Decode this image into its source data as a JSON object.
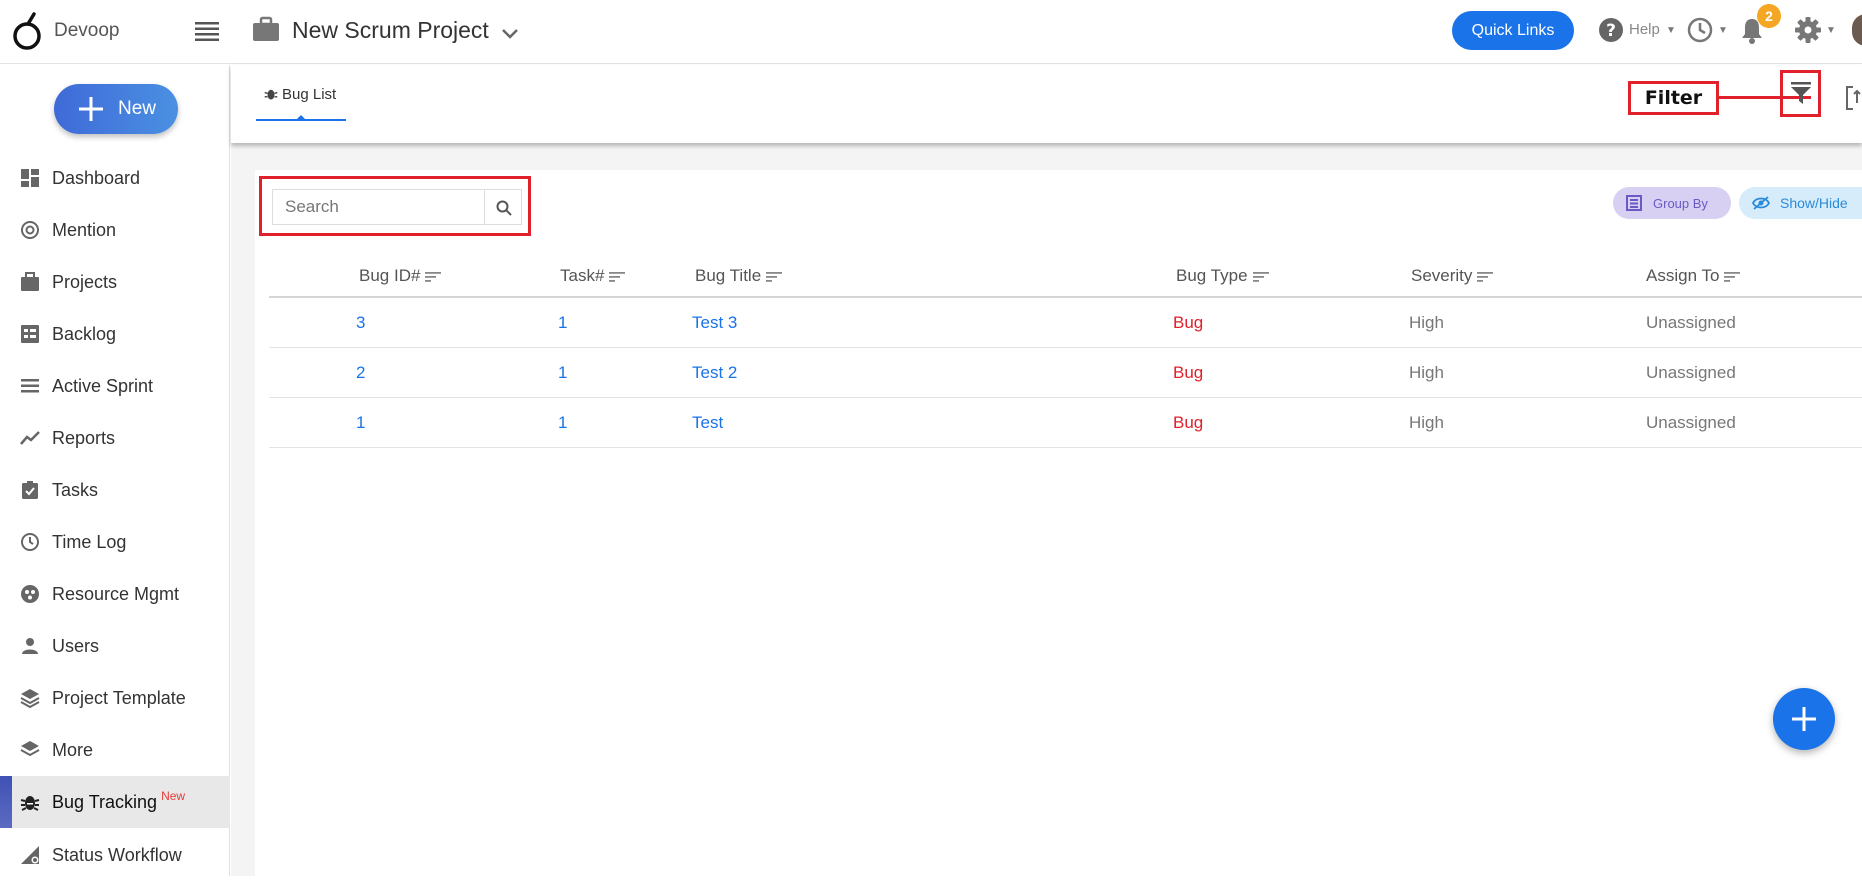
{
  "header": {
    "logo_text": "Devoop",
    "project_title": "New Scrum Project",
    "quick_links": "Quick Links",
    "help_label": "Help",
    "notification_count": "2"
  },
  "sidebar": {
    "new_button": "New",
    "items": [
      {
        "label": "Dashboard",
        "icon": "dashboard-icon"
      },
      {
        "label": "Mention",
        "icon": "at-icon"
      },
      {
        "label": "Projects",
        "icon": "briefcase-icon"
      },
      {
        "label": "Backlog",
        "icon": "backlog-icon"
      },
      {
        "label": "Active Sprint",
        "icon": "sprint-icon"
      },
      {
        "label": "Reports",
        "icon": "trend-icon"
      },
      {
        "label": "Tasks",
        "icon": "clipboard-check-icon"
      },
      {
        "label": "Time Log",
        "icon": "clock-icon"
      },
      {
        "label": "Resource Mgmt",
        "icon": "resource-icon"
      },
      {
        "label": "Users",
        "icon": "user-icon"
      },
      {
        "label": "Project Template",
        "icon": "layers-icon"
      },
      {
        "label": "More",
        "icon": "layers-icon"
      },
      {
        "label": "Bug Tracking",
        "icon": "bug-icon",
        "tag": "New",
        "active": true
      },
      {
        "label": "Status Workflow",
        "icon": "workflow-icon"
      }
    ]
  },
  "tabs": {
    "bug_list": "Bug List"
  },
  "annotation": {
    "filter_label": "Filter"
  },
  "toolbar": {
    "search_placeholder": "Search",
    "group_by": "Group By",
    "show_hide": "Show/Hide"
  },
  "table": {
    "columns": [
      "Bug ID#",
      "Task#",
      "Bug Title",
      "Bug Type",
      "Severity",
      "Assign To"
    ],
    "rows": [
      {
        "id": "3",
        "task": "1",
        "title": "Test 3",
        "type": "Bug",
        "severity": "High",
        "assign": "Unassigned"
      },
      {
        "id": "2",
        "task": "1",
        "title": "Test 2",
        "type": "Bug",
        "severity": "High",
        "assign": "Unassigned"
      },
      {
        "id": "1",
        "task": "1",
        "title": "Test",
        "type": "Bug",
        "severity": "High",
        "assign": "Unassigned"
      }
    ]
  },
  "colors": {
    "accent": "#1a73e8",
    "bug_type": "#e0202a",
    "callout": "#e0202a",
    "notification_badge": "#f5a623"
  }
}
